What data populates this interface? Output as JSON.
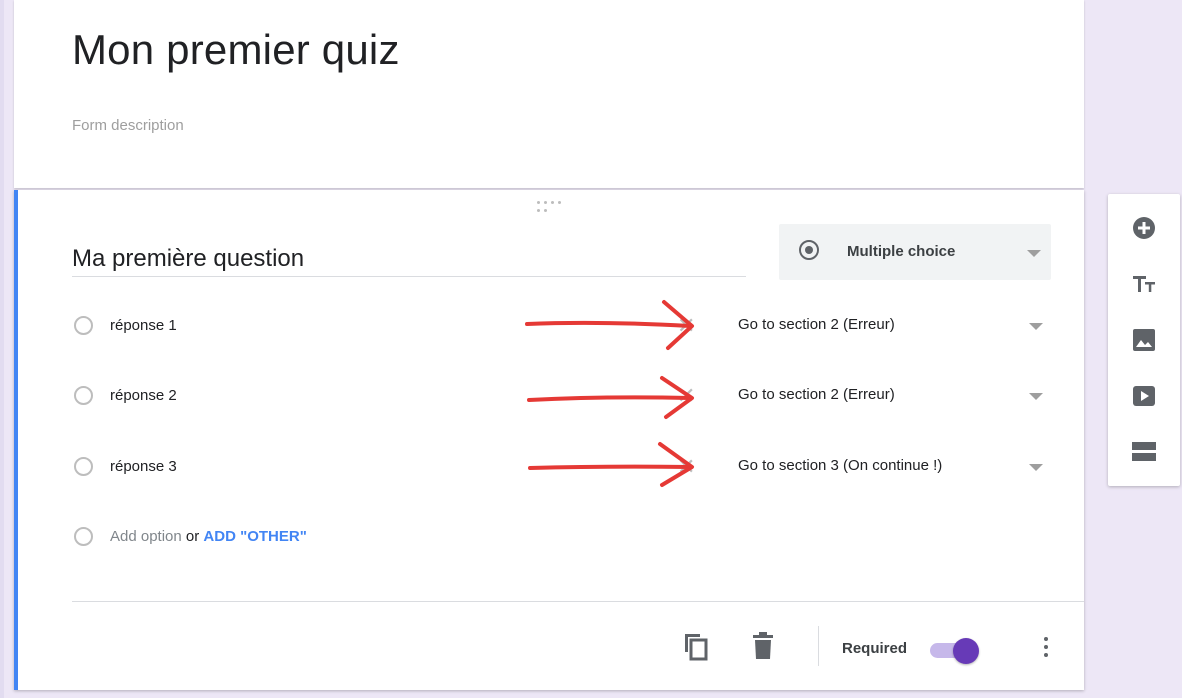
{
  "form": {
    "title": "Mon premier quiz",
    "description_placeholder": "Form description"
  },
  "question": {
    "title": "Ma première question",
    "type_label": "Multiple choice",
    "options": [
      {
        "label": "réponse 1",
        "goto": "Go to section 2 (Erreur)"
      },
      {
        "label": "réponse 2",
        "goto": "Go to section 2 (Erreur)"
      },
      {
        "label": "réponse 3",
        "goto": "Go to section 3 (On continue !)"
      }
    ],
    "add_option": "Add option",
    "add_or": "or",
    "add_other": "ADD \"OTHER\"",
    "required_label": "Required",
    "required": true
  },
  "toolbar": {
    "buttons": [
      "add-question-icon",
      "title-text-icon",
      "image-icon",
      "video-icon",
      "section-icon"
    ]
  },
  "colors": {
    "accent": "#4285f4",
    "brand": "#673ab7",
    "background": "#ede7f6",
    "annotation_arrow": "#e53935"
  }
}
